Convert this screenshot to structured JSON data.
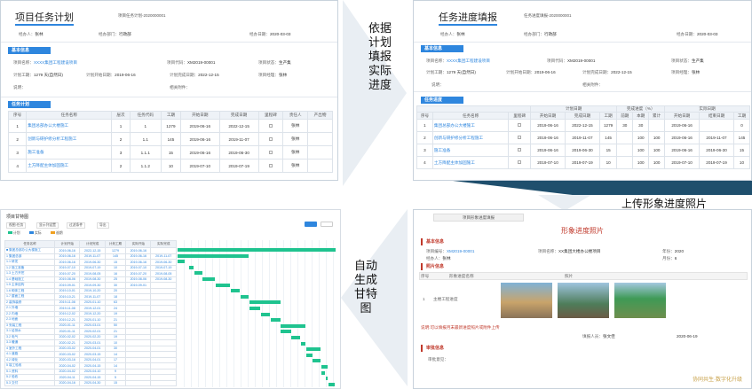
{
  "plan": {
    "title": "项目任务计划",
    "no": "项目任务计划-2020000001",
    "fields": [
      {
        "k": "经办人：",
        "v": "张林"
      },
      {
        "k": "经办部门：",
        "v": "行政部"
      },
      {
        "k": "经办日期：",
        "v": "2020-03-03"
      }
    ],
    "sec_basic": "基本信息",
    "basic": [
      {
        "k": "项目名称：",
        "v": "XXXX集团工程建设项目"
      },
      {
        "k": "项目代码：",
        "v": "XM2019-00001"
      },
      {
        "k": "项目状态：",
        "v": "生产集"
      },
      {
        "k": "计划工期：",
        "v": "1279 天(自然日)"
      },
      {
        "k": "计划开始日期：",
        "v": "2019-06-16"
      },
      {
        "k": "计划完成日期：",
        "v": "2022-12-15"
      },
      {
        "k": "项目经理：",
        "v": "张林"
      },
      {
        "k": "说明：",
        "v": ""
      },
      {
        "k": "相关附件：",
        "v": ""
      }
    ],
    "sec_task": "任务计划",
    "headers": [
      "序号",
      "任务名称",
      "层次",
      "任务代码",
      "工期",
      "开始日期",
      "完成日期",
      "里程碑",
      "责任人",
      "产出物"
    ],
    "rows": [
      [
        "1",
        "集团总部办公大楼施工",
        "1",
        "1",
        "1279",
        "2019-06-16",
        "2022-12-15",
        "",
        "张林",
        ""
      ],
      [
        "2",
        "创新与研护修分析工程施工",
        "2",
        "1.1",
        "145",
        "2019-06-16",
        "2019-11-07",
        "",
        "张林",
        ""
      ],
      [
        "3",
        "施工准备",
        "3",
        "1.1.1",
        "15",
        "2019-06-16",
        "2019-06-30",
        "",
        "张林",
        ""
      ],
      [
        "4",
        "土方降配主体加固施工",
        "2",
        "1.1.2",
        "10",
        "2019-07-10",
        "2019-07-19",
        "",
        "张林",
        ""
      ]
    ]
  },
  "arrow1": "依据计划填报实际进度",
  "progress": {
    "title": "任务进度填报",
    "no": "任务进度填报-2020000001",
    "fields": [
      {
        "k": "经办人：",
        "v": "张林"
      },
      {
        "k": "经办部门：",
        "v": "行政部"
      },
      {
        "k": "经办日期：",
        "v": "2020-03-03"
      }
    ],
    "sec_basic": "基本信息",
    "basic": [
      {
        "k": "项目名称：",
        "v": "XXXX集团工程建设项目"
      },
      {
        "k": "项目代码：",
        "v": "XM2019-00001"
      },
      {
        "k": "项目状态：",
        "v": "生产集"
      },
      {
        "k": "计划工期：",
        "v": "1279 天(自然日)"
      },
      {
        "k": "计划开始日期：",
        "v": "2019-06-16"
      },
      {
        "k": "计划完成日期：",
        "v": "2022-12-15"
      },
      {
        "k": "项目经理：",
        "v": "张林"
      },
      {
        "k": "说明：",
        "v": ""
      },
      {
        "k": "相关附件：",
        "v": ""
      }
    ],
    "sec_task": "任务进度",
    "head_groups": [
      "计划日期",
      "完成进度（%）",
      "实际日期"
    ],
    "headers": [
      "序号",
      "任务名称",
      "里程碑",
      "开始日期",
      "完成日期",
      "工期",
      "前期",
      "本期",
      "累计",
      "开始日期",
      "结束日期",
      "工期"
    ],
    "rows": [
      [
        "1",
        "集团总部办公大楼施工",
        "",
        "2019-06-16",
        "2022-12-15",
        "1279",
        "30",
        "30",
        "",
        "2019-06-16",
        "",
        "0"
      ],
      [
        "2",
        "创新与研护修分析工程施工",
        "",
        "2019-06-16",
        "2019-11-07",
        "145",
        "",
        "100",
        "100",
        "2019-06-16",
        "2019-11-07",
        "145"
      ],
      [
        "3",
        "施工准备",
        "",
        "2019-06-16",
        "2019-06-30",
        "15",
        "",
        "100",
        "100",
        "2019-06-16",
        "2019-06-30",
        "15"
      ],
      [
        "4",
        "土方降配主体加固施工",
        "",
        "2019-07-10",
        "2019-07-19",
        "10",
        "",
        "100",
        "100",
        "2019-07-10",
        "2019-07-19",
        "10"
      ]
    ]
  },
  "arrow2": "上传形象进度照片",
  "photo": {
    "tab": "项目形象进度填报",
    "title": "形象进度照片",
    "sec_basic": "基本信息",
    "basic": [
      {
        "k": "项目编号：",
        "v": "XM2019-00001"
      },
      {
        "k": "项目名称：",
        "v": "XX集团大楼办公楼项目"
      },
      {
        "k": "年份：",
        "v": "2020"
      },
      {
        "k": "经办人：",
        "v": "张林"
      },
      {
        "k": "月份：",
        "v": "6"
      }
    ],
    "sec_photo": "照片信息",
    "photo_headers": [
      "序号",
      "形象进度名称",
      "照片"
    ],
    "photo_row": {
      "no": "1",
      "name": "主楼工程进度"
    },
    "note": "说明:可以填报月末最新进度照片或附件上传",
    "sign": [
      {
        "k": "填报人员：",
        "v": "张文佳"
      },
      {
        "k": "",
        "v": "2020-06-19"
      }
    ],
    "sec_approve": "审批信息",
    "approve_k": "审批意见：",
    "watermark": "协同共生·数字化升级"
  },
  "arrow3": "自动生成甘特图",
  "gantt": {
    "title": "项目甘特图",
    "toolbar": [
      "视图:任务",
      "显示列设置",
      "过滤条件",
      "导出"
    ],
    "legend": [
      "计划",
      "实际",
      "逾期"
    ],
    "headers": [
      "任务名称",
      "计划开始",
      "计划完成",
      "计划工期",
      "实际开始",
      "实际完成"
    ],
    "rows": [
      [
        "■ 集团总部办公大楼施工",
        "2019-06-16",
        "2022-12-15",
        "1279",
        "2019-06-16",
        ""
      ],
      [
        "  1 集团总部",
        "2019-06-16",
        "2019-11-07",
        "145",
        "2019-06-16",
        "2019-11-07"
      ],
      [
        "  1.1 研发",
        "2019-06-16",
        "2019-06-30",
        "15",
        "2019-06-16",
        "2019-06-30"
      ],
      [
        "  1.2 施工准备",
        "2019-07-10",
        "2019-07-19",
        "10",
        "2019-07-10",
        "2019-07-19"
      ],
      [
        "  1.3 土方开挖",
        "2019-07-20",
        "2019-08-05",
        "16",
        "2019-07-20",
        "2019-08-05"
      ],
      [
        "  1.4 基础施工",
        "2019-08-06",
        "2019-08-30",
        "25",
        "2019-08-06",
        "2019-08-30"
      ],
      [
        "  1.5 主体结构",
        "2019-09-01",
        "2019-09-30",
        "30",
        "2019-09-01",
        ""
      ],
      [
        "  1.6 砌体工程",
        "2019-10-01",
        "2019-10-20",
        "20",
        "",
        ""
      ],
      [
        "  1.7 屋面工程",
        "2019-10-21",
        "2019-11-07",
        "18",
        "",
        ""
      ],
      [
        "  2 装饰装修",
        "2019-11-08",
        "2020-01-10",
        "63",
        "",
        ""
      ],
      [
        "  2.1 外墙",
        "2019-11-08",
        "2019-12-01",
        "24",
        "",
        ""
      ],
      [
        "  2.2 内墙",
        "2019-12-02",
        "2019-12-20",
        "19",
        "",
        ""
      ],
      [
        "  2.3 地面",
        "2019-12-21",
        "2020-01-10",
        "21",
        "",
        ""
      ],
      [
        "  3 安装工程",
        "2020-01-11",
        "2020-03-01",
        "50",
        "",
        ""
      ],
      [
        "  3.1 给排水",
        "2020-01-11",
        "2020-02-01",
        "21",
        "",
        ""
      ],
      [
        "  3.2 电气",
        "2020-02-02",
        "2020-02-20",
        "19",
        "",
        ""
      ],
      [
        "  3.3 暖通",
        "2020-02-21",
        "2020-03-01",
        "10",
        "",
        ""
      ],
      [
        "  4 室外工程",
        "2020-03-02",
        "2020-04-01",
        "30",
        "",
        ""
      ],
      [
        "  4.1 道路",
        "2020-03-02",
        "2020-03-15",
        "14",
        "",
        ""
      ],
      [
        "  4.2 绿化",
        "2020-03-16",
        "2020-04-01",
        "17",
        "",
        ""
      ],
      [
        "  5 竣工验收",
        "2020-04-02",
        "2020-04-15",
        "14",
        "",
        ""
      ],
      [
        "  5.1 资料",
        "2020-04-02",
        "2020-04-10",
        "9",
        "",
        ""
      ],
      [
        "  5.2 验收",
        "2020-04-11",
        "2020-04-15",
        "5",
        "",
        ""
      ],
      [
        "  5.3 交付",
        "2020-04-16",
        "2020-04-30",
        "15",
        "",
        ""
      ]
    ]
  },
  "colors": {
    "accent": "#2e86de",
    "band": "#1f4f6d",
    "gantt": "#1fc38f"
  }
}
